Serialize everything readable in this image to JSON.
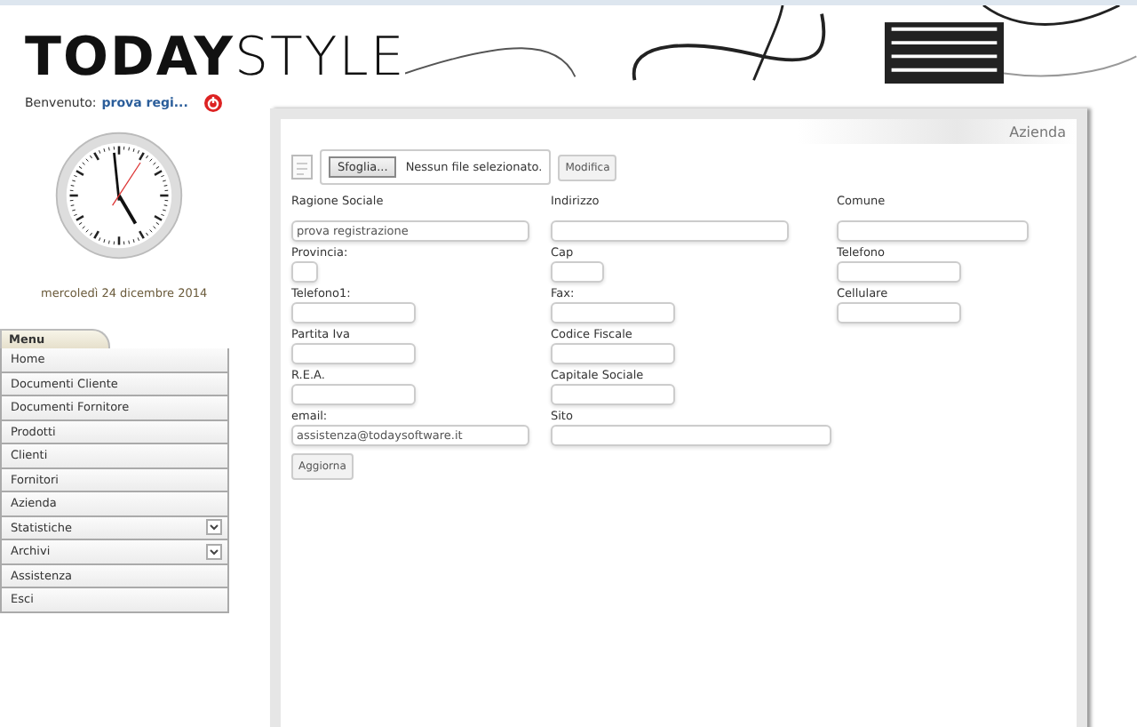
{
  "header": {
    "logo": "**TODAY**STYLE"
  },
  "welcome": {
    "label": "Benvenuto:",
    "user": "prova regi..."
  },
  "date": "mercoledì 24 dicembre 2014",
  "menu": {
    "title": "Menu",
    "items": [
      {
        "label": "Home",
        "expandable": false
      },
      {
        "label": "Documenti Cliente",
        "expandable": false
      },
      {
        "label": "Documenti Fornitore",
        "expandable": false
      },
      {
        "label": "Prodotti",
        "expandable": false
      },
      {
        "label": "Clienti",
        "expandable": false
      },
      {
        "label": "Fornitori",
        "expandable": false
      },
      {
        "label": "Azienda",
        "expandable": false
      },
      {
        "label": "Statistiche",
        "expandable": true
      },
      {
        "label": "Archivi",
        "expandable": true
      },
      {
        "label": "Assistenza",
        "expandable": false
      },
      {
        "label": "Esci",
        "expandable": false
      }
    ]
  },
  "panel": {
    "title": "Azienda",
    "upload": {
      "button": "Sfoglia...",
      "status": "Nessun file selezionato.",
      "action": "Modifica"
    },
    "rows": [
      {
        "kind": "spaced",
        "fields": [
          {
            "label": "Ragione Sociale",
            "kind": "xl",
            "value": "prova registrazione"
          },
          {
            "label": "Indirizzo",
            "kind": "xl"
          },
          {
            "label": "Comune",
            "kind": "l"
          }
        ]
      },
      {
        "kind": "tight",
        "fields": [
          {
            "label": "Provincia:",
            "kind": "xs"
          },
          {
            "label": "Cap",
            "kind": "s"
          },
          {
            "label": "Telefono",
            "kind": "m"
          }
        ]
      },
      {
        "kind": "tight",
        "fields": [
          {
            "label": "Telefono1:",
            "kind": "m"
          },
          {
            "label": "Fax:",
            "kind": "m"
          },
          {
            "label": "Cellulare",
            "kind": "m"
          }
        ]
      },
      {
        "kind": "tight",
        "fields": [
          {
            "label": "Partita Iva",
            "kind": "m"
          },
          {
            "label": "Codice Fiscale",
            "kind": "m"
          }
        ]
      },
      {
        "kind": "tight",
        "fields": [
          {
            "label": "R.E.A.",
            "kind": "m"
          },
          {
            "label": "Capitale Sociale",
            "kind": "m"
          }
        ]
      },
      {
        "kind": "tight",
        "fields": [
          {
            "label": "email:",
            "kind": "xl",
            "value": "assistenza@todaysoftware.it"
          },
          {
            "label": "Sito",
            "kind": "xxl"
          }
        ]
      }
    ],
    "submit": "Aggiorna"
  }
}
